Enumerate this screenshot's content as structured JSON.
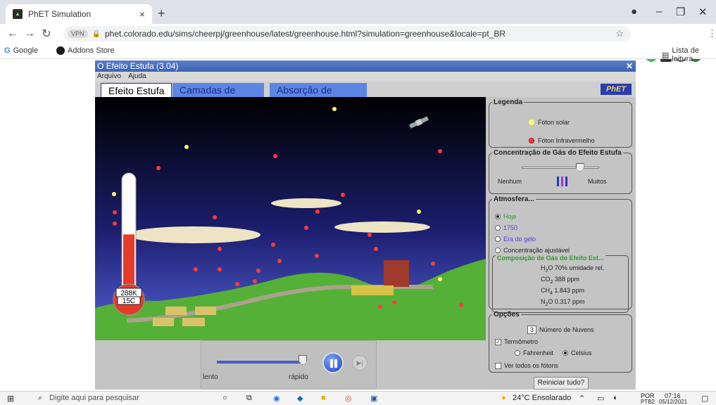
{
  "browser": {
    "tab_title": "PhET Simulation",
    "url": "phet.colorado.edu/sims/cheerpj/greenhouse/latest/greenhouse.html?simulation=greenhouse&locale=pt_BR",
    "vpn_badge": "VPN",
    "bookmarks": [
      "Google",
      "Addons Store"
    ],
    "reading_list": "Lista de leitura"
  },
  "app": {
    "title": "O Efeito Estufa (3.04)",
    "menu": [
      "Arquivo",
      "Ajuda"
    ],
    "tabs": [
      "Efeito Estufa",
      "Camadas de Vidro",
      "Absorção de Fóton"
    ],
    "logo": "PhET"
  },
  "scene": {
    "thermo_k": "288K",
    "thermo_c": "15C",
    "thermo_level": 0.55
  },
  "playback": {
    "slow": "lento",
    "fast": "rápido"
  },
  "panel": {
    "legend_title": "Legenda",
    "solar_photon": "Fóton solar",
    "ir_photon": "Fóton Infravermelho",
    "gas_title": "Concentração de Gás do Efeito Estufa",
    "gas_none": "Nenhum",
    "gas_many": "Muitos",
    "gas_level": 0.75,
    "atm_title": "Atmosfera...",
    "atm_options": [
      "Hoje",
      "1750",
      "Era do gelo",
      "Concentração ajustável"
    ],
    "atm_selected": 0,
    "comp_title": "Composição de Gás do Efeito Est...",
    "comp": [
      {
        "gas": "H",
        "sub": "2",
        "rest": "O",
        "val": "70% umidade rel."
      },
      {
        "gas": "CO",
        "sub": "2",
        "rest": "",
        "val": "388 ppm"
      },
      {
        "gas": "CH",
        "sub": "4",
        "rest": "",
        "val": "1.843 ppm"
      },
      {
        "gas": "N",
        "sub": "2",
        "rest": "O",
        "val": "0.317 ppm"
      }
    ],
    "opts_title": "Opções",
    "clouds_count": "3",
    "clouds_label": "Número de Nuvens",
    "thermometer_label": "Termômetro",
    "fahrenheit": "Fahrenheit",
    "celsius": "Celsius",
    "all_photons": "Ver todos os fótons",
    "reset": "Reiniciar tudo?"
  },
  "taskbar": {
    "search": "Digite aqui para pesquisar",
    "weather": "24°C Ensolarado",
    "lang": "POR",
    "lang2": "PTB2",
    "time": "07:16",
    "date": "05/12/2021"
  }
}
